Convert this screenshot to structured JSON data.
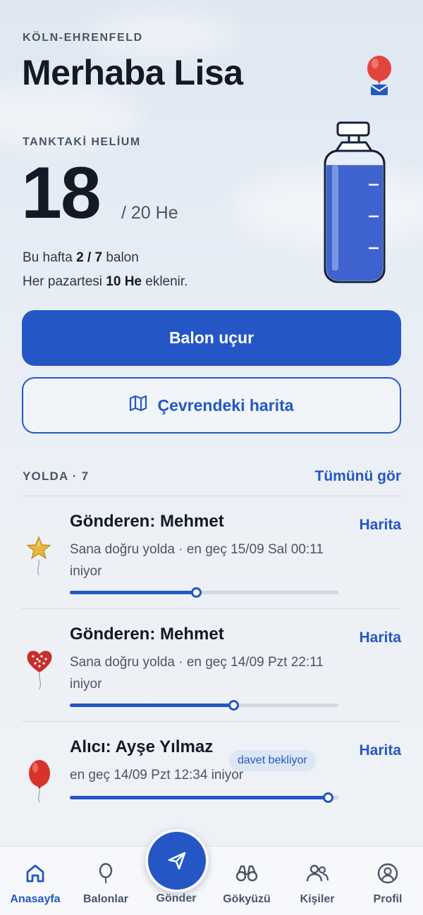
{
  "header": {
    "location": "KÖLN-EHRENFELD",
    "greeting": "Merhaba Lisa",
    "notification_icon": "balloon-mail-icon"
  },
  "tank": {
    "label": "TANKTAKİ HELİUM",
    "value": "18",
    "max": "/ 20 He",
    "fill_fraction": 0.9,
    "week_prefix": "Bu hafta ",
    "week_count": "2 / 7",
    "week_suffix": " balon",
    "refill_prefix": "Her pazartesi ",
    "refill_amount": "10 He",
    "refill_suffix": " eklenir."
  },
  "actions": {
    "launch_label": "Balon uçur",
    "map_label": "Çevrendeki harita",
    "map_icon": "map-icon"
  },
  "in_transit": {
    "title": "YOLDA · 7",
    "see_all": "Tümünü gör",
    "items": [
      {
        "icon": "star-balloon-icon",
        "title": "Gönderen: Mehmet",
        "subtitle": "Sana doğru yolda · en geç 15/09 Sal 00:11 iniyor",
        "badge": "",
        "action": "Harita",
        "progress": 0.47
      },
      {
        "icon": "heart-balloon-icon",
        "title": "Gönderen: Mehmet",
        "subtitle": "Sana doğru yolda · en geç 14/09 Pzt 22:11 iniyor",
        "badge": "",
        "action": "Harita",
        "progress": 0.61
      },
      {
        "icon": "red-balloon-icon",
        "title": "Alıcı: Ayşe Yılmaz",
        "subtitle": "en geç 14/09 Pzt 12:34 iniyor",
        "badge": "davet bekliyor",
        "action": "Harita",
        "progress": 0.96
      }
    ]
  },
  "tabbar": {
    "home": "Anasayfa",
    "balloons": "Balonlar",
    "send": "Gönder",
    "sky": "Gökyüzü",
    "people": "Kişiler",
    "profile": "Profil"
  },
  "colors": {
    "accent": "#2457c5",
    "text": "#121a28",
    "muted": "#4a5566"
  }
}
